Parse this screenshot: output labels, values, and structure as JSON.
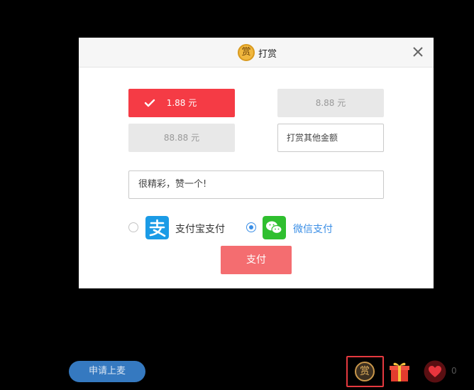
{
  "dialog": {
    "title": "打赏",
    "badge_char": "赏",
    "close_icon": "close-icon"
  },
  "amounts": {
    "option1": "1.88 元",
    "option2": "8.88 元",
    "option3": "88.88 元",
    "other_placeholder": "打赏其他金额",
    "selected": "1.88 元"
  },
  "message": {
    "value": "很精彩，赞一个!"
  },
  "payment": {
    "alipay_label": "支付宝支付",
    "wechat_label": "微信支付",
    "selected": "微信支付",
    "pay_button": "支付"
  },
  "toolbar": {
    "mic_button": "申请上麦",
    "reward_char": "赏",
    "like_count": "0"
  },
  "colors": {
    "accent_red": "#f53b45",
    "pay_button": "#f46d70",
    "radio_blue": "#3a8ee6",
    "mic_blue": "#3579c0"
  }
}
